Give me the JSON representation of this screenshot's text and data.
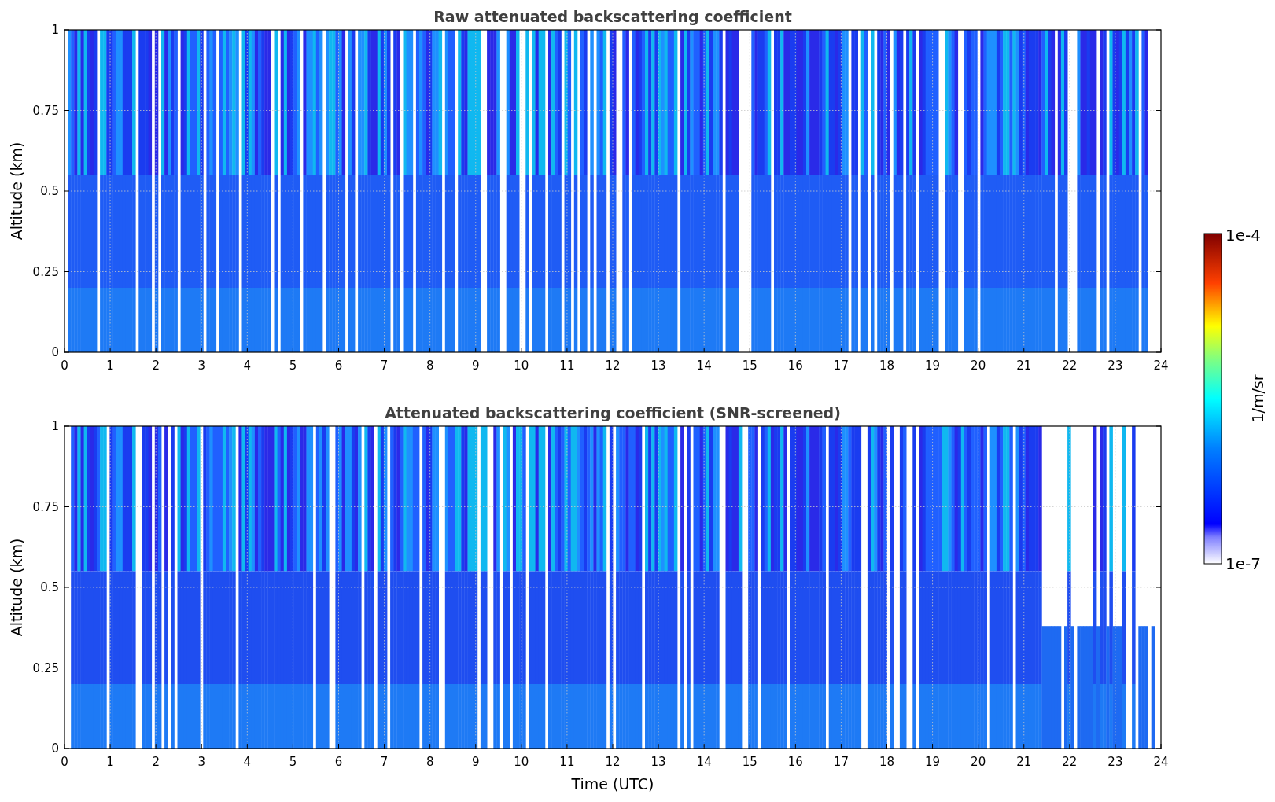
{
  "panels": [
    {
      "title": "Raw attenuated backscattering coefficient",
      "ylabel": "Altitude (km)",
      "yticks": [
        "1",
        "0.75",
        "0.5",
        "0.25",
        "0"
      ],
      "xticks": [
        "0",
        "1",
        "2",
        "3",
        "4",
        "5",
        "6",
        "7",
        "8",
        "9",
        "10",
        "11",
        "12",
        "13",
        "14",
        "15",
        "16",
        "17",
        "18",
        "19",
        "20",
        "21",
        "22",
        "23",
        "24"
      ],
      "screened": false
    },
    {
      "title": "Attenuated backscattering coefficient (SNR-screened)",
      "ylabel": "Altitude (km)",
      "yticks": [
        "1",
        "0.75",
        "0.5",
        "0.25",
        "0"
      ],
      "xticks": [
        "0",
        "1",
        "2",
        "3",
        "4",
        "5",
        "6",
        "7",
        "8",
        "9",
        "10",
        "11",
        "12",
        "13",
        "14",
        "15",
        "16",
        "17",
        "18",
        "19",
        "20",
        "21",
        "22",
        "23",
        "24"
      ],
      "xlabel": "Time (UTC)",
      "screened": true
    }
  ],
  "colorbar": {
    "max_label": "1e-4",
    "min_label": "1e-7",
    "label": "1/m/sr"
  }
}
